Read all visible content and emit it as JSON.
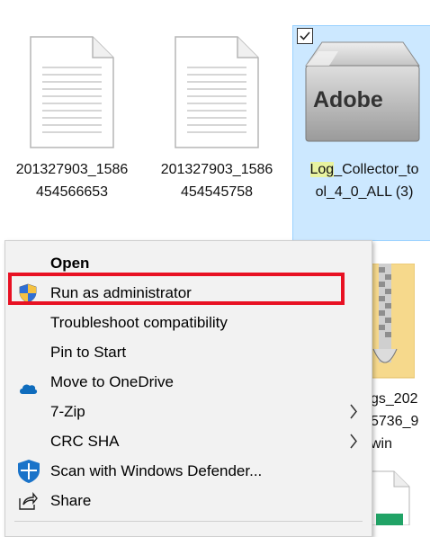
{
  "files": [
    {
      "line1": "201327903_1586",
      "line2": "454566653",
      "icon": "text-document-icon"
    },
    {
      "line1": "201327903_1586",
      "line2": "454545758",
      "icon": "text-document-icon"
    },
    {
      "line1_hl": "Log",
      "line1_rest": "_Collector_to",
      "line2": "ol_4_0_ALL (3)",
      "icon": "adobe-installer-box-icon",
      "box_text": "Adobe"
    }
  ],
  "partial_files": [
    {
      "line1": "gs_202",
      "line2": "5736_9",
      "line3": "win",
      "icon": "zip-folder-icon"
    }
  ],
  "context_menu": {
    "items": [
      {
        "label": "Open"
      },
      {
        "label": "Run as administrator",
        "icon": "uac-shield-icon"
      },
      {
        "label": "Troubleshoot compatibility"
      },
      {
        "label": "Pin to Start"
      },
      {
        "label": "Move to OneDrive",
        "icon": "onedrive-cloud-icon"
      },
      {
        "label": "7-Zip",
        "submenu": "›"
      },
      {
        "label": "CRC SHA",
        "submenu": "›"
      },
      {
        "label": "Scan with Windows Defender...",
        "icon": "windows-defender-shield-icon"
      },
      {
        "label": "Share",
        "icon": "share-icon"
      }
    ]
  },
  "colors": {
    "selection": "#cce8ff",
    "highlight_box": "#e81123",
    "menu_bg": "#f2f2f2"
  }
}
